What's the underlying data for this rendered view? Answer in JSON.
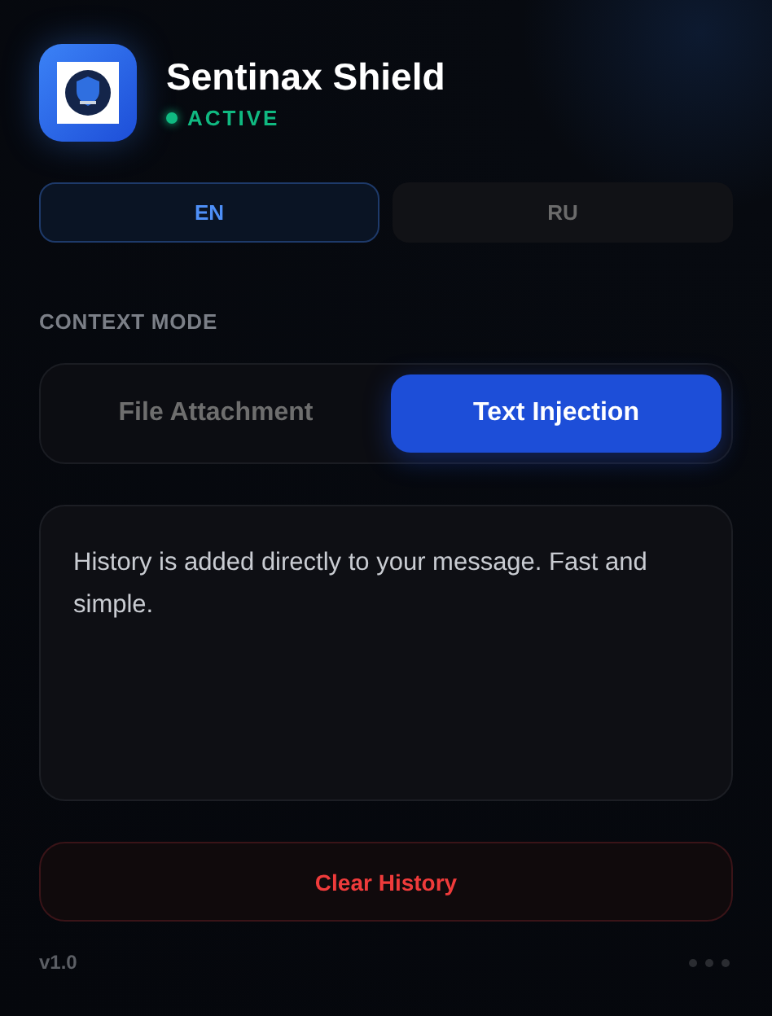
{
  "app": {
    "title": "Sentinax Shield",
    "status": "ACTIVE",
    "active": true
  },
  "languages": [
    {
      "label": "EN",
      "selected": true
    },
    {
      "label": "RU",
      "selected": false
    }
  ],
  "context_mode": {
    "label": "CONTEXT MODE",
    "options": [
      {
        "label": "File Attachment",
        "selected": false
      },
      {
        "label": "Text Injection",
        "selected": true
      }
    ]
  },
  "description": "History is added directly to your message. Fast and simple.",
  "clear_button": "Clear History",
  "footer": {
    "version": "v1.0"
  }
}
